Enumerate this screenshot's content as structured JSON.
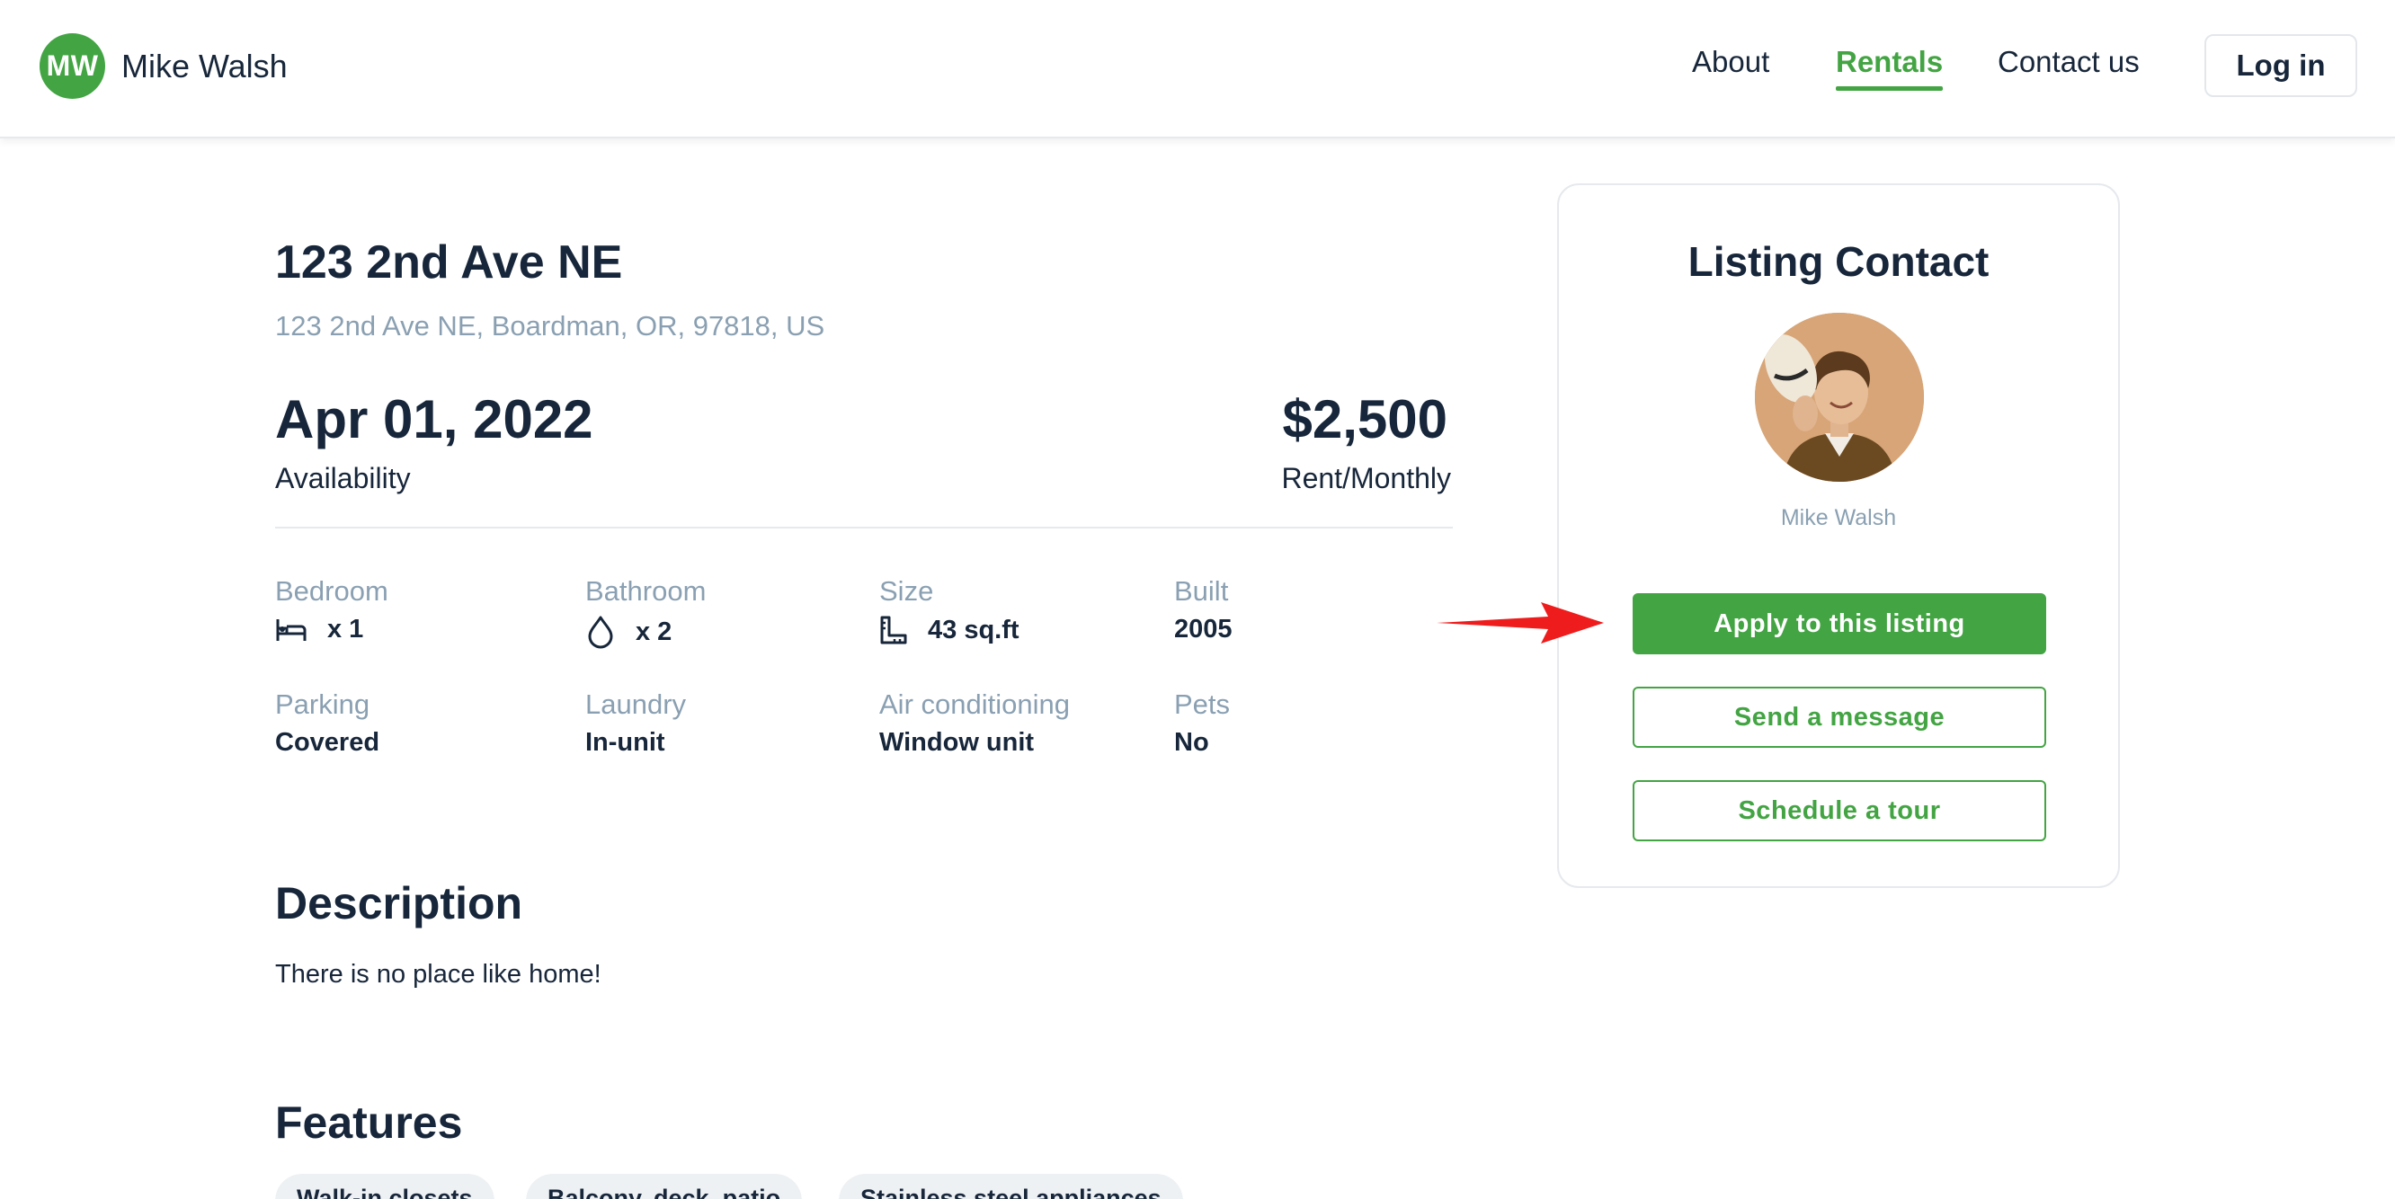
{
  "header": {
    "brand_initials": "MW",
    "brand_name": "Mike Walsh",
    "nav": {
      "about": "About",
      "rentals": "Rentals",
      "contact": "Contact us"
    },
    "login": "Log in"
  },
  "listing": {
    "title": "123 2nd Ave NE",
    "address": "123 2nd Ave NE, Boardman, OR, 97818, US",
    "availability_date": "Apr 01, 2022",
    "availability_label": "Availability",
    "price": "$2,500",
    "price_label": "Rent/Monthly",
    "properties": {
      "bedroom": {
        "label": "Bedroom",
        "value": "x 1",
        "icon": "bed-icon"
      },
      "bathroom": {
        "label": "Bathroom",
        "value": "x 2",
        "icon": "water-drop-icon"
      },
      "size": {
        "label": "Size",
        "value": "43 sq.ft",
        "icon": "ruler-icon"
      },
      "built": {
        "label": "Built",
        "value": "2005"
      },
      "parking": {
        "label": "Parking",
        "value": "Covered"
      },
      "laundry": {
        "label": "Laundry",
        "value": "In-unit"
      },
      "air_conditioning": {
        "label": "Air conditioning",
        "value": "Window unit"
      },
      "pets": {
        "label": "Pets",
        "value": "No"
      }
    },
    "description_heading": "Description",
    "description": "There is no place like home!",
    "features_heading": "Features",
    "features": [
      "Walk-in closets",
      "Balcony, deck, patio",
      "Stainless steel appliances"
    ]
  },
  "contact_card": {
    "title": "Listing Contact",
    "name": "Mike Walsh",
    "apply": "Apply to this listing",
    "message": "Send a message",
    "tour": "Schedule a tour"
  },
  "colors": {
    "accent": "#43a443",
    "text": "#17263a",
    "muted": "#8aa0b2",
    "annotation_arrow": "#ee1c1c"
  }
}
